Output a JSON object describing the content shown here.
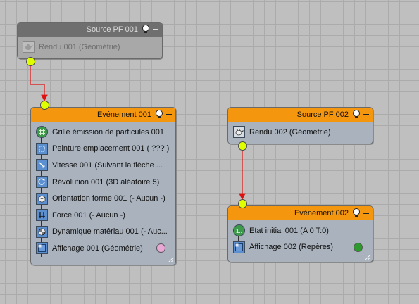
{
  "nodes": {
    "source1": {
      "title": "Source PF 001",
      "items": [
        {
          "label": "Rendu 001 (Géométrie)",
          "icon": "teapot-icon"
        }
      ]
    },
    "event1": {
      "title": "Evénement 001",
      "items": [
        {
          "label": "Grille émission de particules 001",
          "icon": "grid-emitter-icon"
        },
        {
          "label": "Peinture emplacement 001 ( ??? )",
          "icon": "position-paint-icon"
        },
        {
          "label": "Vitesse 001 (Suivant la flèche ...",
          "icon": "speed-icon"
        },
        {
          "label": "Révolution 001 (3D aléatoire 5)",
          "icon": "rotation-icon"
        },
        {
          "label": "Orientation forme 001 (- Aucun -)",
          "icon": "shape-cube-icon"
        },
        {
          "label": "Force 001 (- Aucun -)",
          "icon": "force-arrows-icon"
        },
        {
          "label": "Dynamique matériau 001 (- Auc...",
          "icon": "material-sphere-icon"
        },
        {
          "label": "Affichage 001 (Géométrie)",
          "icon": "display-icon"
        }
      ],
      "display_color": "#e7a8d6"
    },
    "source2": {
      "title": "Source PF 002",
      "items": [
        {
          "label": "Rendu 002 (Géométrie)",
          "icon": "teapot-icon"
        }
      ]
    },
    "event2": {
      "title": "Evénement 002",
      "items": [
        {
          "label": "Etat initial 001 (A 0 T:0)",
          "icon": "initial-state-icon"
        },
        {
          "label": "Affichage 002 (Repères)",
          "icon": "display-icon"
        }
      ],
      "display_color": "#2e9a2e"
    }
  },
  "colors": {
    "header_active": "#f5960f",
    "header_inactive": "#6f6f6f",
    "socket": "#dfff00",
    "wire": "#e01010"
  }
}
